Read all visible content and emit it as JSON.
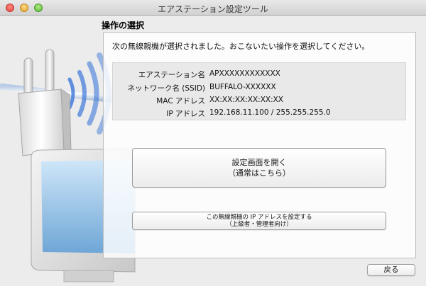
{
  "window": {
    "title": "エアステーション設定ツール"
  },
  "section_title": "操作の選択",
  "instruction": "次の無線親機が選択されました。おこないたい操作を選択してください。",
  "info": [
    {
      "label": "エアステーション名",
      "value": "APXXXXXXXXXXXX"
    },
    {
      "label": "ネットワーク名 (SSID)",
      "value": "BUFFALO-XXXXXX"
    },
    {
      "label": "MAC アドレス",
      "value": "XX:XX:XX:XX:XX:XX"
    },
    {
      "label": "IP アドレス",
      "value": "192.168.11.100 / 255.255.255.0"
    }
  ],
  "buttons": {
    "open_settings_line1": "設定画面を開く",
    "open_settings_line2": "（通常はこちら）",
    "set_ip_line1": "この無線親機の IP アドレスを設定する",
    "set_ip_line2": "（上級者・管理者向け）",
    "back": "戻る"
  }
}
